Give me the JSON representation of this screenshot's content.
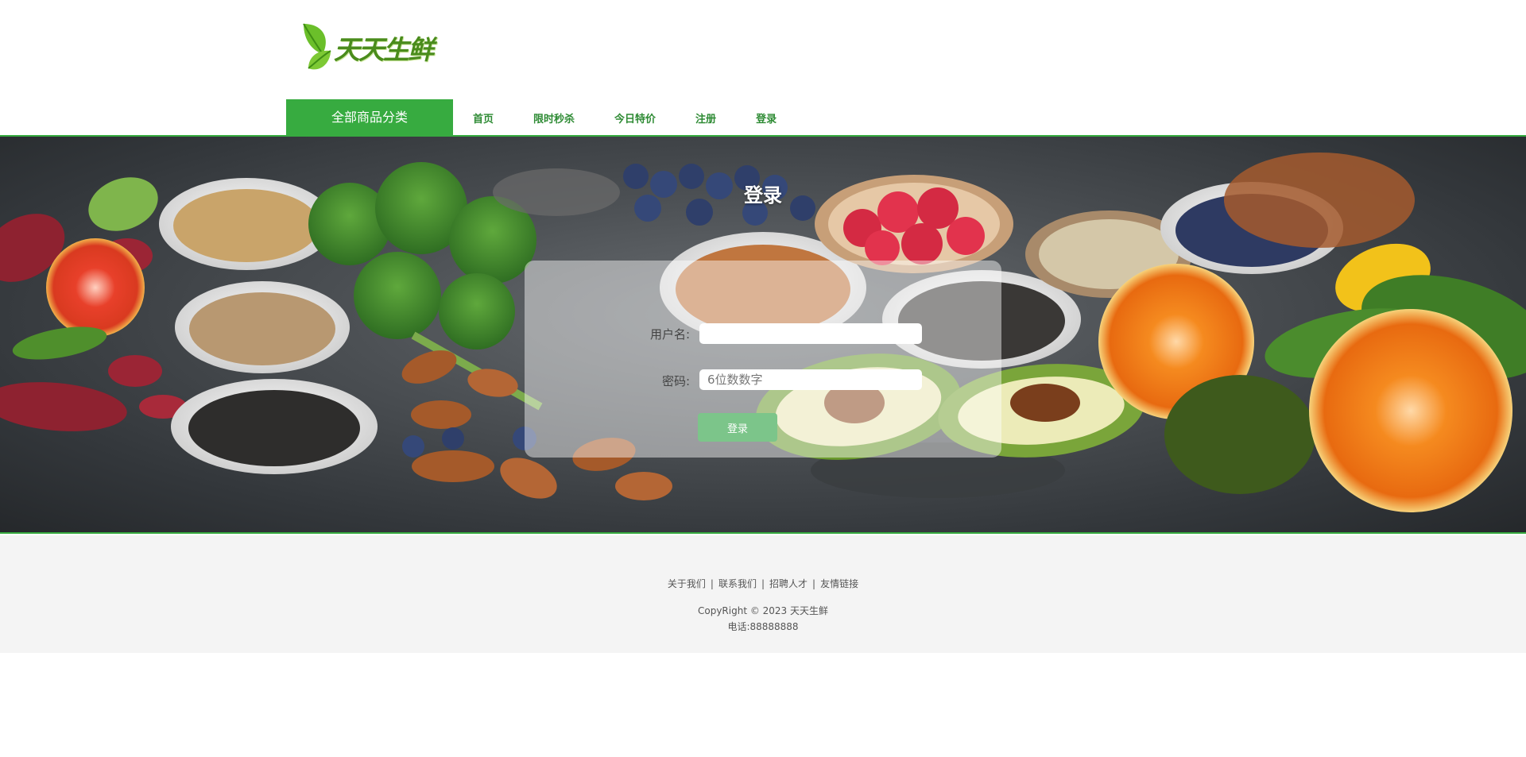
{
  "brand": {
    "logo_text": "天天生鲜",
    "colors": {
      "primary": "#37ab40",
      "leaf": "#6bbf2a"
    }
  },
  "header": {
    "category_label": "全部商品分类",
    "nav": [
      {
        "label": "首页"
      },
      {
        "label": "限时秒杀"
      },
      {
        "label": "今日特价"
      },
      {
        "label": "注册"
      },
      {
        "label": "登录"
      }
    ]
  },
  "login": {
    "title": "登录",
    "username_label": "用户名:",
    "username_value": "",
    "password_label": "密码:",
    "password_placeholder": "6位数数字",
    "submit_label": "登录"
  },
  "footer": {
    "links": [
      "关于我们",
      "联系我们",
      "招聘人才",
      "友情链接"
    ],
    "copyright": "CopyRight © 2023 天天生鲜",
    "phone": "电话:88888888"
  }
}
